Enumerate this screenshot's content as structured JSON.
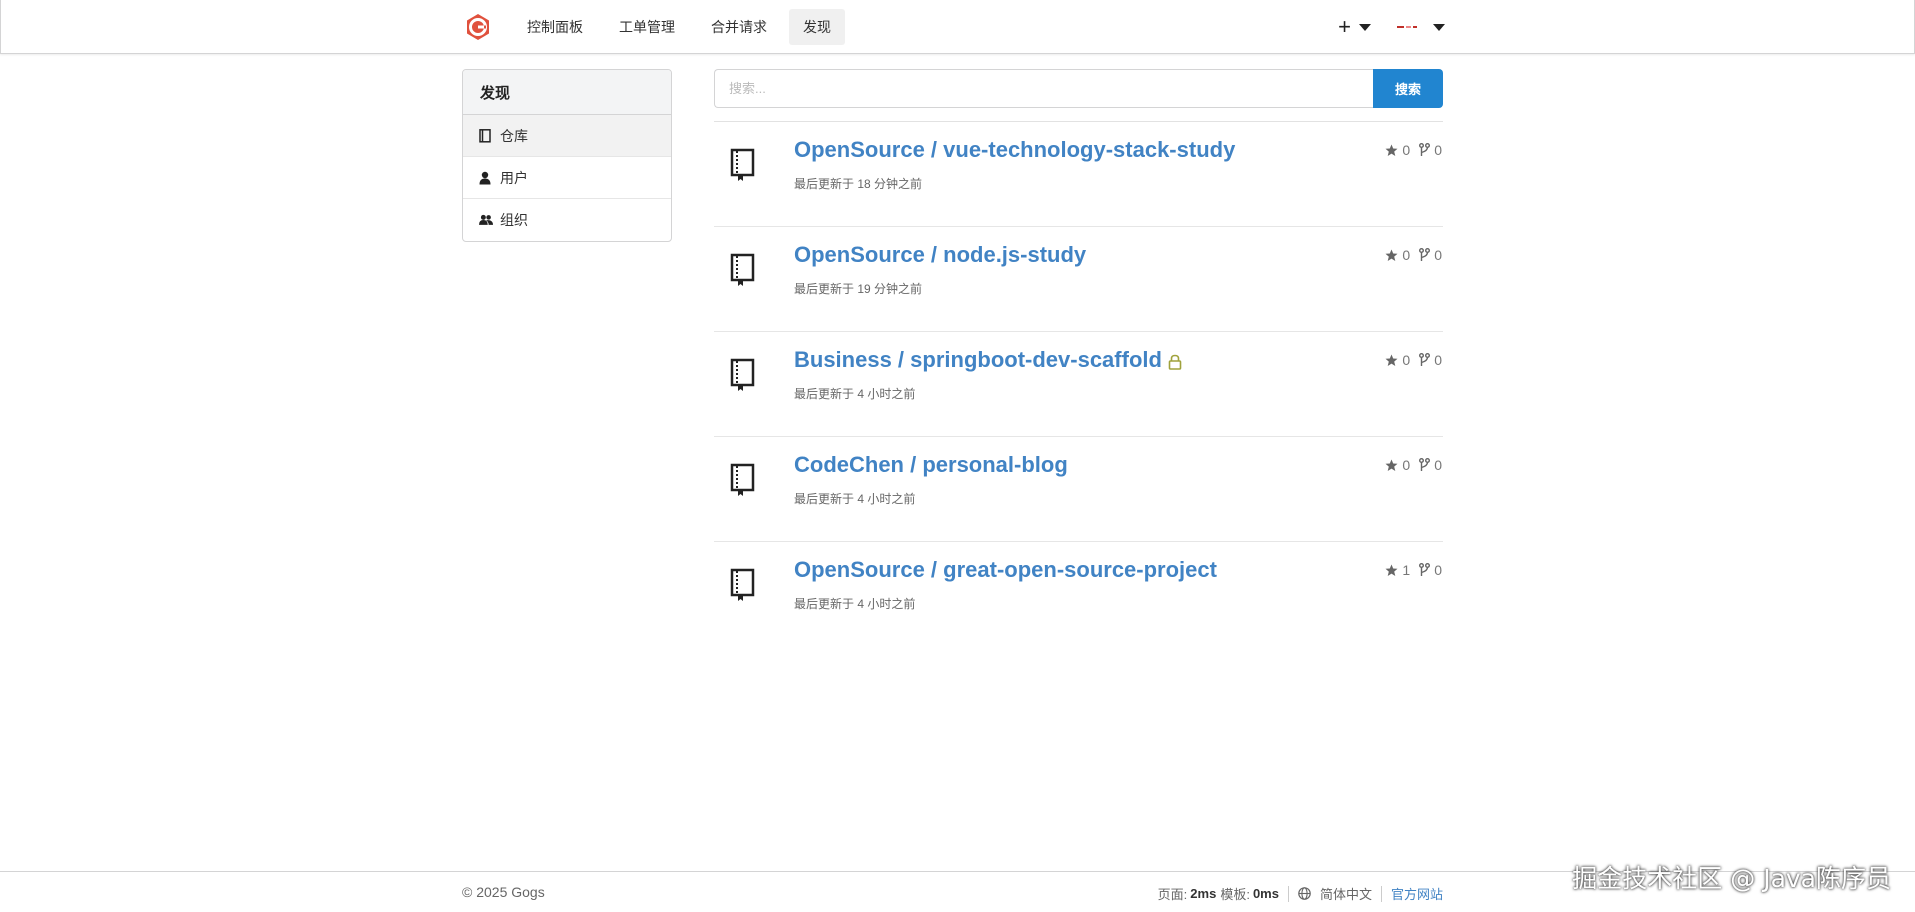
{
  "nav": {
    "items": [
      {
        "label": "控制面板",
        "active": false
      },
      {
        "label": "工单管理",
        "active": false
      },
      {
        "label": "合并请求",
        "active": false
      },
      {
        "label": "发现",
        "active": true
      }
    ],
    "logo_icon": "gogs-logo-icon",
    "create_icon": "plus-icon"
  },
  "sidebar": {
    "title": "发现",
    "items": [
      {
        "label": "仓库",
        "icon": "book-icon",
        "active": true
      },
      {
        "label": "用户",
        "icon": "user-icon",
        "active": false
      },
      {
        "label": "组织",
        "icon": "users-icon",
        "active": false
      }
    ]
  },
  "search": {
    "placeholder": "搜索...",
    "button": "搜索"
  },
  "repos": [
    {
      "name": "OpenSource / vue-technology-stack-study",
      "updated": "最后更新于 18 分钟之前",
      "stars": "0",
      "forks": "0",
      "private": false
    },
    {
      "name": "OpenSource / node.js-study",
      "updated": "最后更新于 19 分钟之前",
      "stars": "0",
      "forks": "0",
      "private": false
    },
    {
      "name": "Business / springboot-dev-scaffold",
      "updated": "最后更新于 4 小时之前",
      "stars": "0",
      "forks": "0",
      "private": true
    },
    {
      "name": "CodeChen / personal-blog",
      "updated": "最后更新于 4 小时之前",
      "stars": "0",
      "forks": "0",
      "private": false
    },
    {
      "name": "OpenSource / great-open-source-project",
      "updated": "最后更新于 4 小时之前",
      "stars": "1",
      "forks": "0",
      "private": false
    }
  ],
  "footer": {
    "copyright": "© 2025 Gogs",
    "page_label": "页面:",
    "page_time": "2ms",
    "tpl_label": "模板:",
    "tpl_time": "0ms",
    "language": "简体中文",
    "site": "官方网站"
  },
  "watermark": "掘金技术社区 @ Java陈序员",
  "colors": {
    "accent": "#2185d0",
    "link": "#4183c4",
    "logo": "#e0513d"
  }
}
